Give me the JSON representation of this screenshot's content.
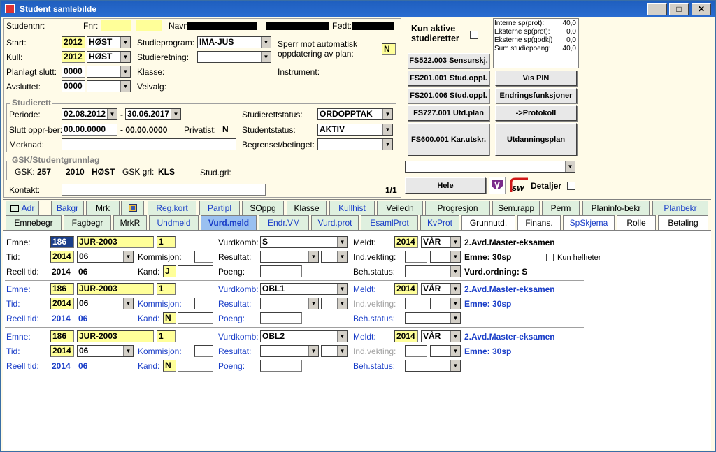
{
  "window": {
    "title": "Student samlebilde",
    "min": "_",
    "max": "□",
    "close": "✕"
  },
  "head": {
    "studentnr_label": "Studentnr:",
    "fnr_label": "Fnr:",
    "navn_label": "Navn:",
    "fodt_label": "Født:",
    "start_label": "Start:",
    "start_year": "2012",
    "start_term": "HØST",
    "kull_label": "Kull:",
    "kull_year": "2012",
    "kull_term": "HØST",
    "planlagt_label": "Planlagt slutt:",
    "planlagt_year": "0000",
    "avsluttet_label": "Avsluttet:",
    "avsluttet_year": "0000",
    "studieprogram_label": "Studieprogram:",
    "studieprogram": "IMA-JUS",
    "studieretning_label": "Studieretning:",
    "klasse_label": "Klasse:",
    "veivalg_label": "Veivalg:",
    "sperr_label1": "Sperr mot automatisk",
    "sperr_label2": "oppdatering av plan:",
    "sperr_value": "N",
    "instrument_label": "Instrument:"
  },
  "studierett": {
    "title": "Studierett",
    "periode_label": "Periode:",
    "periode_from": "02.08.2012",
    "periode_dash": "-",
    "periode_to": "30.06.2017",
    "slutt_label": "Slutt oppr-ber:",
    "slutt_from": "00.00.0000",
    "slutt_to": "- 00.00.0000",
    "privatist_label": "Privatist:",
    "privatist_value": "N",
    "merknad_label": "Merknad:",
    "studierettstatus_label": "Studierettstatus:",
    "studierettstatus": "ORDOPPTAK",
    "studentstatus_label": "Studentstatus:",
    "studentstatus": "AKTIV",
    "begrenset_label": "Begrenset/betinget:"
  },
  "gsk": {
    "title": "GSK/Studentgrunnlag",
    "gsk_label": "GSK:",
    "gsk_value": "257",
    "year": "2010",
    "term": "HØST",
    "grl_label": "GSK grl:",
    "grl_value": "KLS",
    "studgrl_label": "Stud.grl:"
  },
  "kontakt": {
    "label": "Kontakt:",
    "counter": "1/1"
  },
  "right": {
    "kun_aktive1": "Kun aktive",
    "kun_aktive2": "studieretter",
    "points": [
      {
        "label": "Interne sp(prot):",
        "value": "40,0"
      },
      {
        "label": "Eksterne sp(prot):",
        "value": "0,0"
      },
      {
        "label": "Eksterne sp(godkj)",
        "value": "0,0"
      },
      {
        "label": "Sum studiepoeng:",
        "value": "40,0"
      }
    ],
    "btn_sensur": "FS522.003 Sensurskj.",
    "btn_studoppl1": "FS201.001 Stud.oppl.",
    "btn_vispin": "Vis PIN",
    "btn_studoppl2": "FS201.006 Stud.oppl.",
    "btn_endring": "Endringsfunksjoner",
    "btn_utdplan": "FS727.001 Utd.plan",
    "btn_protokoll": "->Protokoll",
    "btn_karutskr": "FS600.001 Kar.utskr.",
    "btn_utdanningsplan": "Utdanningsplan",
    "btn_hele": "Hele",
    "logo_text": "sw",
    "detaljer": "Detaljer"
  },
  "tabs_row1": [
    "Adr",
    "Bakgr",
    "Mrk",
    "",
    "Reg.kort",
    "Partipl",
    "SOppg",
    "Klasse",
    "Kullhist",
    "Veiledn",
    "Progresjon",
    "Sem.rapp",
    "Perm",
    "Planinfo-bekr",
    "Planbekr"
  ],
  "tabs_row2": [
    "Emnebegr",
    "Fagbegr",
    "MrkR",
    "Undmeld",
    "Vurd.meld",
    "Endr.VM",
    "Vurd.prot",
    "EsamlProt",
    "KvProt",
    "Grunnutd.",
    "Finans.",
    "SpSkjema",
    "Rolle",
    "Betaling"
  ],
  "labels": {
    "emne": "Emne:",
    "tid": "Tid:",
    "reell": "Reell tid:",
    "kommisjon": "Kommisjon:",
    "kand": "Kand:",
    "vurdkomb": "Vurdkomb:",
    "resultat": "Resultat:",
    "poeng": "Poeng:",
    "meldt": "Meldt:",
    "indvekting": "Ind.vekting:",
    "behstatus": "Beh.status:",
    "kun_helheter": "Kun helheter"
  },
  "records": [
    {
      "inst": "186",
      "emne": "JUR-2003",
      "versjon": "1",
      "tid_year": "2014",
      "tid_term": "06",
      "reell_year": "2014",
      "reell_term": "06",
      "kand": "J",
      "vurdkomb": "S",
      "meldt_year": "2014",
      "meldt_term": "VÅR",
      "title": "2.Avd.Master-eksamen",
      "emne_sp": "Emne: 30sp",
      "ordning": "Vurd.ordning: S"
    },
    {
      "inst": "186",
      "emne": "JUR-2003",
      "versjon": "1",
      "tid_year": "2014",
      "tid_term": "06",
      "reell_year": "2014",
      "reell_term": "06",
      "kand": "N",
      "vurdkomb": "OBL1",
      "meldt_year": "2014",
      "meldt_term": "VÅR",
      "title": "2.Avd.Master-eksamen",
      "emne_sp": "Emne: 30sp"
    },
    {
      "inst": "186",
      "emne": "JUR-2003",
      "versjon": "1",
      "tid_year": "2014",
      "tid_term": "06",
      "reell_year": "2014",
      "reell_term": "06",
      "kand": "N",
      "vurdkomb": "OBL2",
      "meldt_year": "2014",
      "meldt_term": "VÅR",
      "title": "2.Avd.Master-eksamen",
      "emne_sp": "Emne: 30sp"
    }
  ]
}
